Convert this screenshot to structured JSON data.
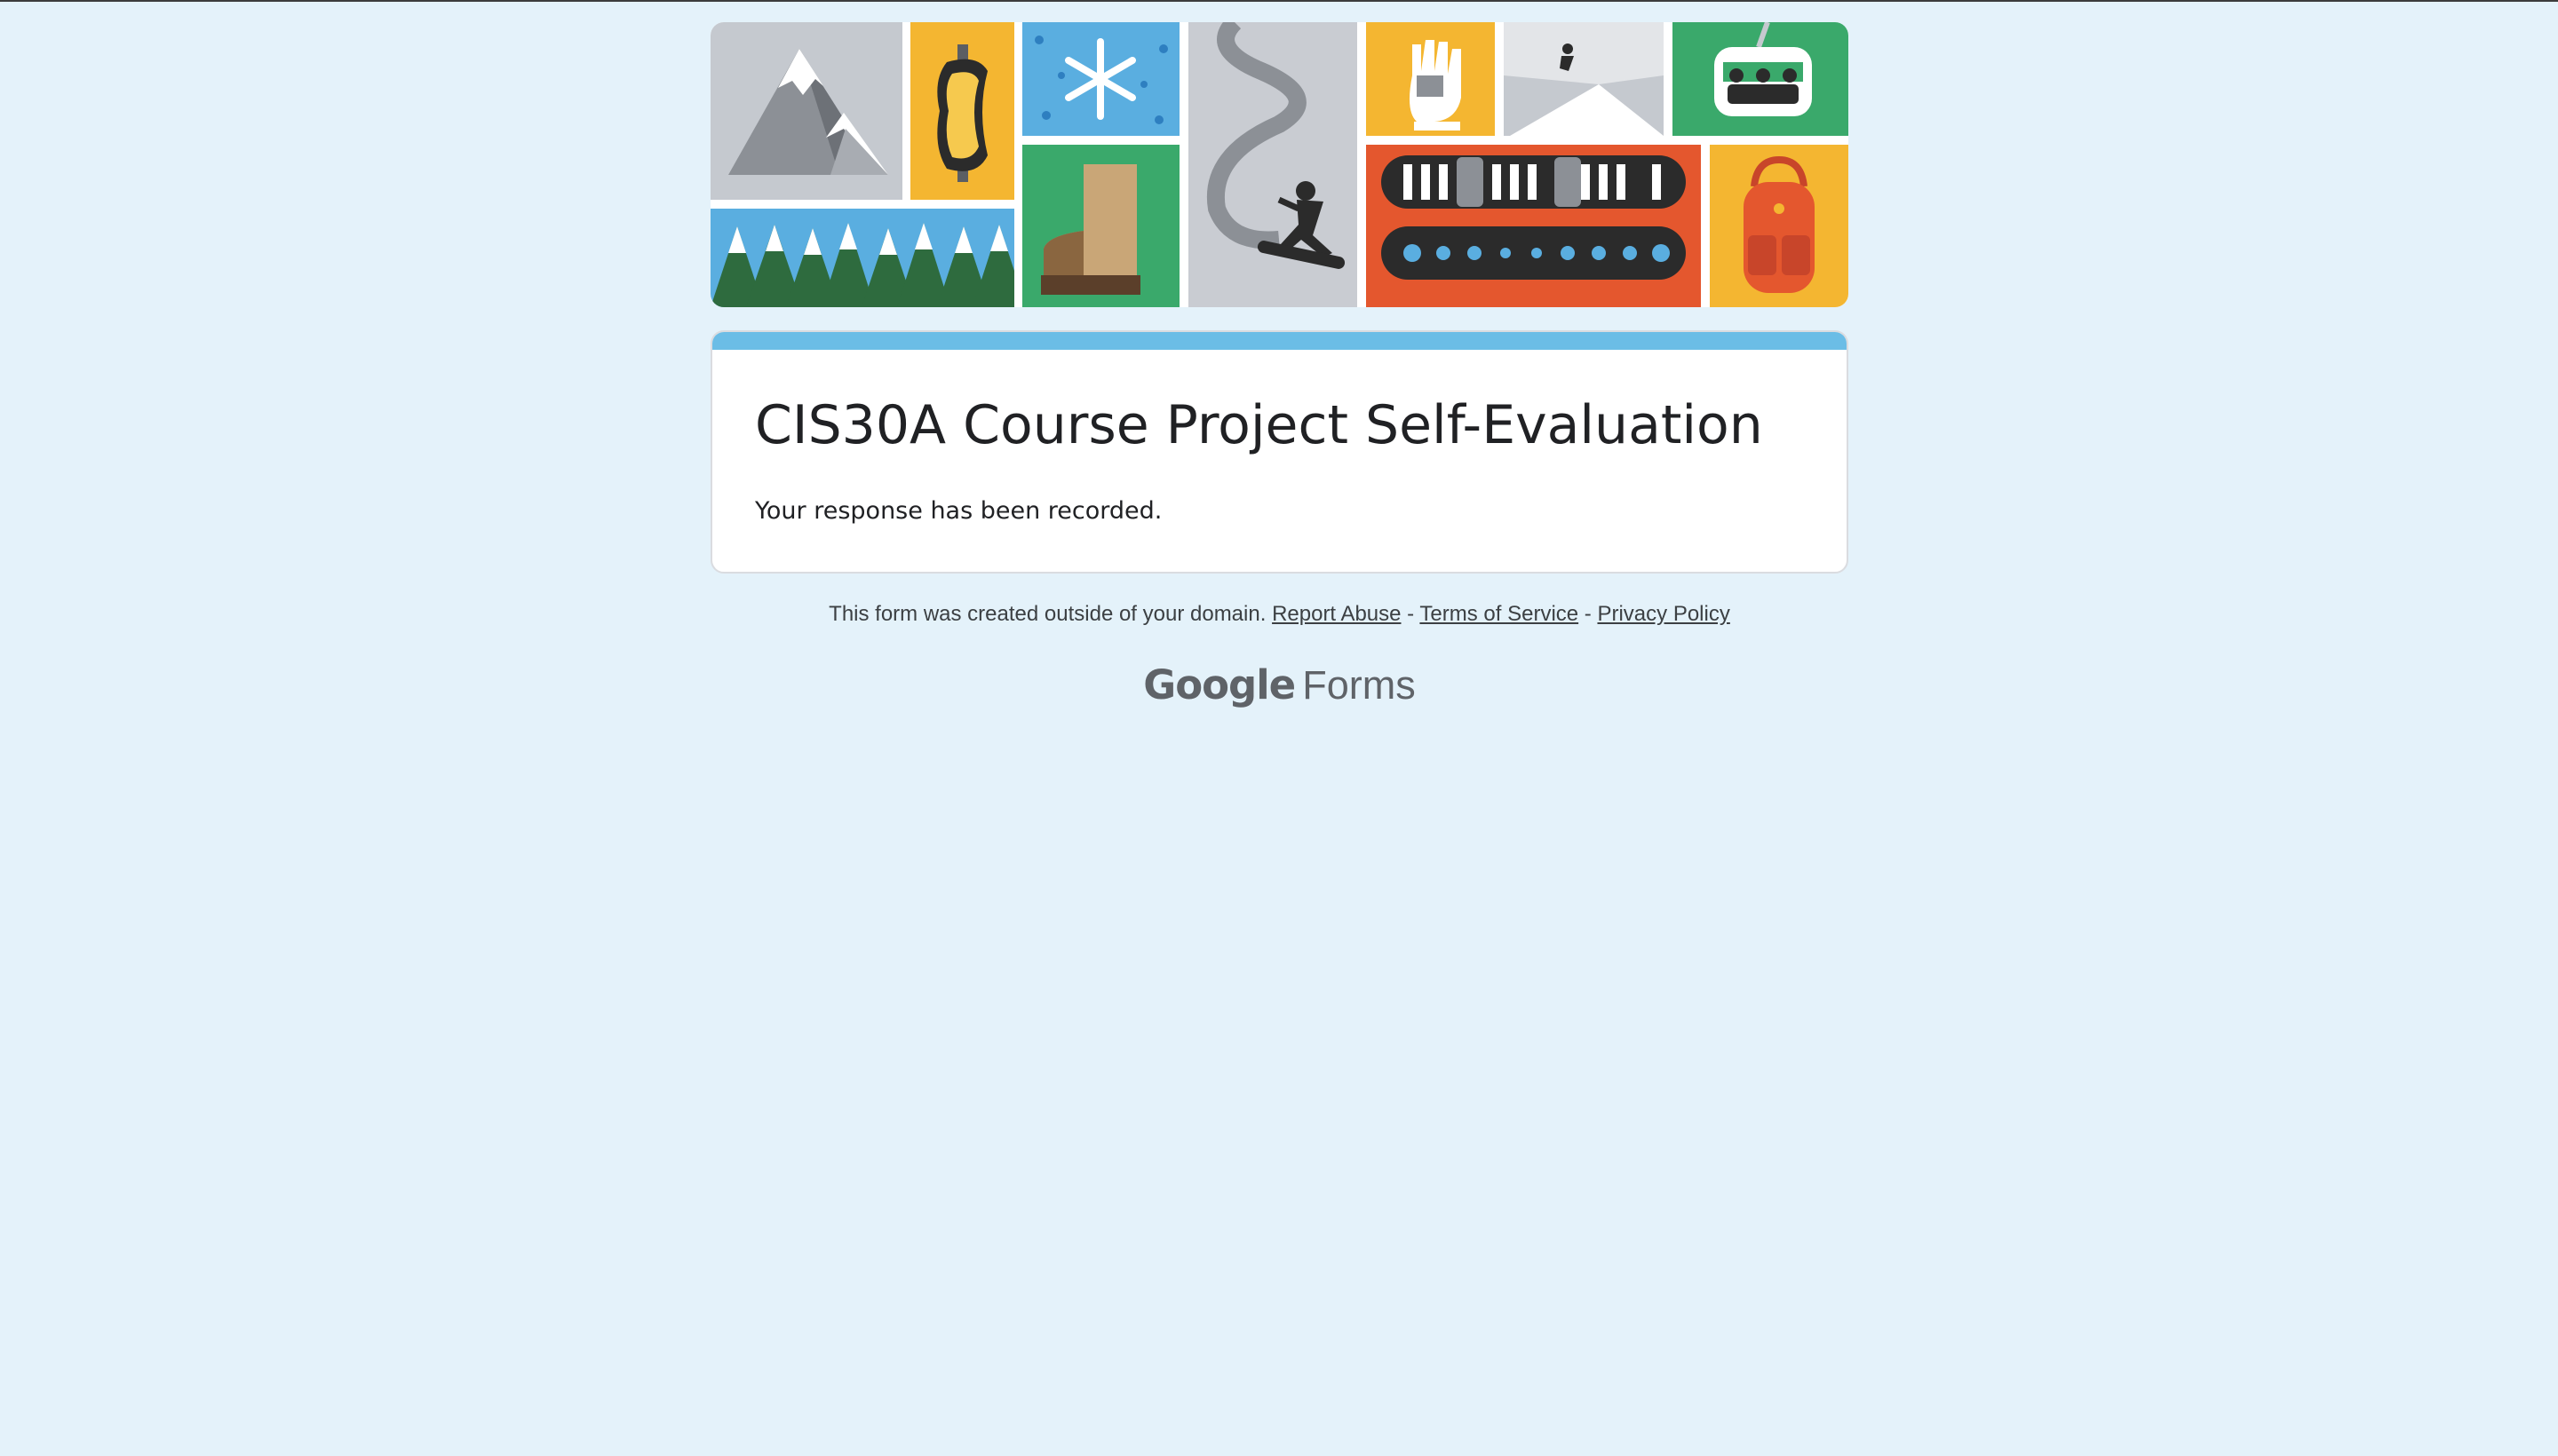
{
  "form": {
    "title": "CIS30A Course Project Self-Evaluation",
    "message": "Your response has been recorded."
  },
  "footer": {
    "notice": "This form was created outside of your domain.",
    "links": [
      "Report Abuse",
      "Terms of Service",
      "Privacy Policy"
    ],
    "separator": "-"
  },
  "brand": {
    "google": "Google",
    "product": "Forms"
  },
  "banner": {
    "theme": "winter-sports",
    "tiles": [
      "mountain-icon",
      "goggles-icon",
      "snowflake-icon",
      "ski-trail-icon",
      "snowboarder-icon",
      "glove-icon",
      "jumper-icon",
      "ski-lift-icon",
      "pine-trees-icon",
      "boot-icon",
      "snowboard-icon",
      "backpack-icon"
    ]
  },
  "colors": {
    "background": "#e4f2fa",
    "accent": "#6bbde6",
    "card": "#ffffff",
    "text": "#202124"
  }
}
